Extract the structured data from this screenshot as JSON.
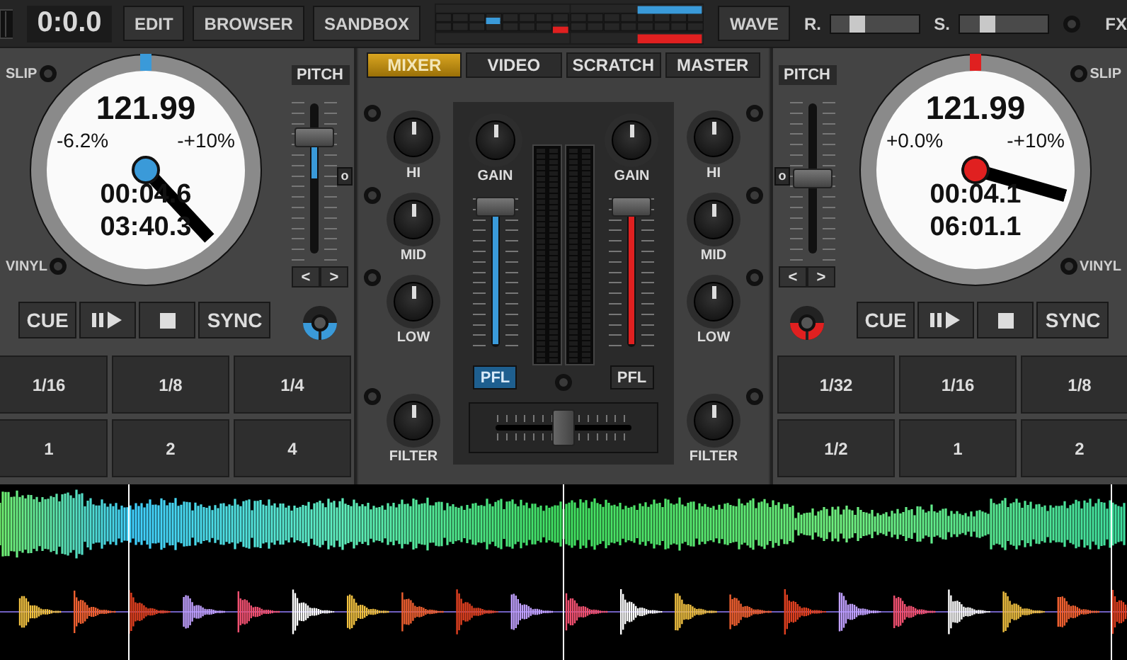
{
  "top_bar": {
    "time": "0:0.0",
    "buttons": [
      "EDIT",
      "BROWSER",
      "SANDBOX"
    ],
    "wave_button": "WAVE",
    "sliders": [
      {
        "label": "R.",
        "level": 0.28
      },
      {
        "label": "S.",
        "level": 0.28
      }
    ],
    "fx_label": "FX"
  },
  "decks": [
    {
      "color": "#3a9ad9",
      "slip_label": "SLIP",
      "vinyl_label": "VINYL",
      "bpm": "121.99",
      "pitch": "-6.2%",
      "range": "-+10%",
      "elapsed": "00:04.6",
      "remaining": "03:40.3",
      "pitch_label": "PITCH",
      "pitch_slider": {
        "level": 0.78
      },
      "reset_button": "o",
      "nudge_buttons": [
        "<",
        ">"
      ],
      "transport": [
        {
          "kind": "text",
          "label": "CUE"
        },
        {
          "kind": "playpause"
        },
        {
          "kind": "stop"
        },
        {
          "kind": "text",
          "label": "SYNC"
        }
      ],
      "pads": [
        "1/16",
        "1/8",
        "1/4",
        "1",
        "2",
        "4"
      ]
    },
    {
      "color": "#e02020",
      "slip_label": "SLIP",
      "vinyl_label": "VINYL",
      "bpm": "121.99",
      "pitch": "+0.0%",
      "range": "-+10%",
      "elapsed": "00:04.1",
      "remaining": "06:01.1",
      "pitch_label": "PITCH",
      "pitch_slider": {
        "level": 0.5
      },
      "reset_button": "o",
      "nudge_buttons": [
        "<",
        ">"
      ],
      "transport": [
        {
          "kind": "text",
          "label": "CUE"
        },
        {
          "kind": "playpause"
        },
        {
          "kind": "stop"
        },
        {
          "kind": "text",
          "label": "SYNC"
        }
      ],
      "pads": [
        "1/32",
        "1/16",
        "1/8",
        "1/2",
        "1",
        "2"
      ]
    }
  ],
  "mixer": {
    "tabs": [
      {
        "label": "MIXER",
        "selected": true
      },
      {
        "label": "VIDEO",
        "selected": false
      },
      {
        "label": "SCRATCH",
        "selected": false
      },
      {
        "label": "MASTER",
        "selected": false
      }
    ],
    "channels": [
      {
        "eq": [
          {
            "label": "HI",
            "level": 0.5
          },
          {
            "label": "MID",
            "level": 0.5
          },
          {
            "label": "LOW",
            "level": 0.5
          },
          {
            "label": "FILTER",
            "level": 0.5
          }
        ],
        "gain": {
          "label": "GAIN",
          "level": 0.5
        },
        "volume": {
          "level": 0.97
        },
        "pfl": {
          "label": "PFL",
          "selected": true
        }
      },
      {
        "eq": [
          {
            "label": "HI",
            "level": 0.5
          },
          {
            "label": "MID",
            "level": 0.5
          },
          {
            "label": "LOW",
            "level": 0.5
          },
          {
            "label": "FILTER",
            "level": 0.5
          }
        ],
        "gain": {
          "label": "GAIN",
          "level": 0.5
        },
        "volume": {
          "level": 0.97
        },
        "pfl": {
          "label": "PFL",
          "selected": false
        }
      }
    ],
    "crossfader": {
      "level": 0.5
    }
  }
}
